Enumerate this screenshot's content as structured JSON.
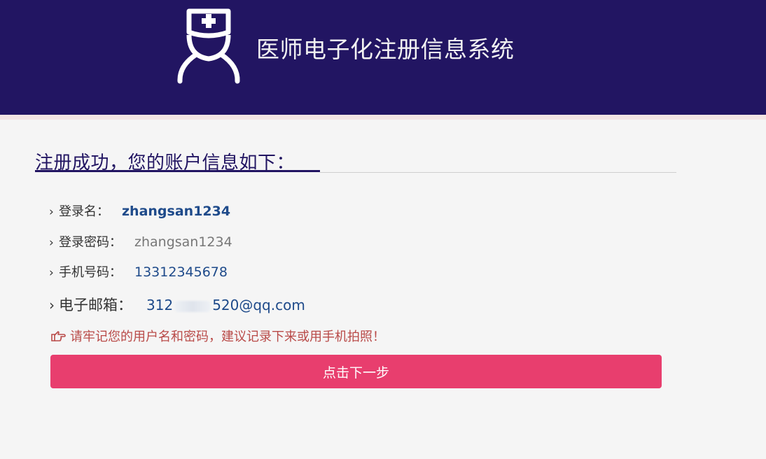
{
  "header": {
    "system_title": "医师电子化注册信息系统",
    "logo_icon": "doctor-nurse-cap-icon",
    "background_color": "#221562"
  },
  "main": {
    "heading": "注册成功，您的账户信息如下：",
    "rows": [
      {
        "label": "登录名：",
        "value": "zhangsan1234"
      },
      {
        "label": "登录密码：",
        "value": "zhangsan1234"
      },
      {
        "label": "手机号码：",
        "value": "13312345678"
      },
      {
        "label": "电子邮箱：",
        "value_prefix": "312",
        "value_suffix": "520@qq.com"
      }
    ],
    "notice_icon": "hand-point-right-icon",
    "notice": "请牢记您的用户名和密码，建议记录下来或用手机拍照！",
    "next_button_label": "点击下一步",
    "button_color": "#e83e6e"
  }
}
